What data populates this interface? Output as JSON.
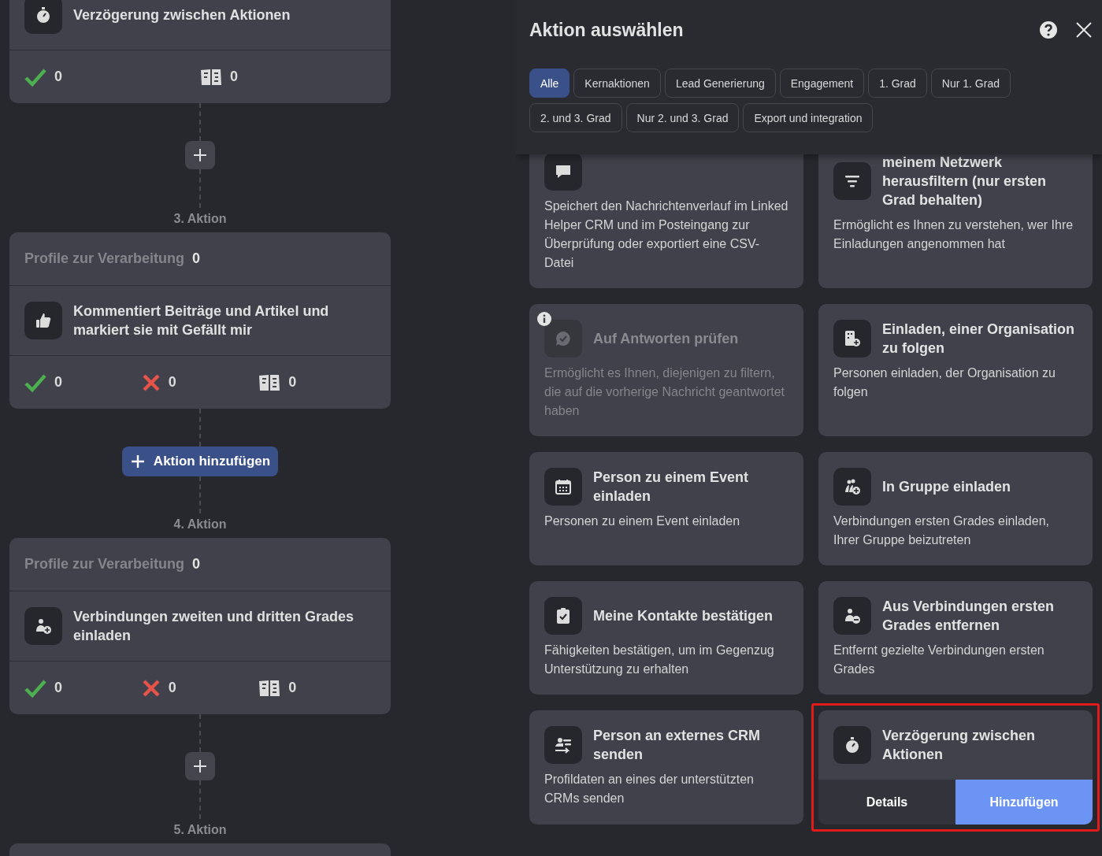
{
  "flow": [
    {
      "kind": "card",
      "action": {
        "kind": "delay",
        "title": "Verzögerung zwischen Aktionen"
      },
      "stats": [
        {
          "kind": "success",
          "value": "0"
        },
        {
          "kind": "skipped",
          "value": "0"
        }
      ]
    },
    {
      "kind": "connector",
      "button": {
        "kind": "plus"
      },
      "step": "3. Aktion"
    },
    {
      "kind": "card",
      "profiles": {
        "label": "Profile zur Verarbeitung",
        "value": "0"
      },
      "action": {
        "kind": "like",
        "title": "Kommentiert Beiträge und Artikel und markiert sie mit Gefällt mir"
      },
      "stats": [
        {
          "kind": "success",
          "value": "0"
        },
        {
          "kind": "failed",
          "value": "0"
        },
        {
          "kind": "skipped",
          "value": "0"
        }
      ]
    },
    {
      "kind": "connector",
      "button": {
        "kind": "labeled",
        "label": "Aktion hinzufügen"
      },
      "step": "4. Aktion"
    },
    {
      "kind": "card",
      "profiles": {
        "label": "Profile zur Verarbeitung",
        "value": "0"
      },
      "action": {
        "kind": "invite",
        "title": "Verbindungen zweiten und dritten Grades einladen"
      },
      "stats": [
        {
          "kind": "success",
          "value": "0"
        },
        {
          "kind": "failed",
          "value": "0"
        },
        {
          "kind": "skipped",
          "value": "0"
        }
      ]
    },
    {
      "kind": "connector",
      "button": {
        "kind": "plus"
      },
      "step": "5. Aktion"
    },
    {
      "kind": "card_stub"
    }
  ],
  "dialog": {
    "title": "Aktion auswählen",
    "filters": [
      {
        "label": "Alle",
        "selected": true
      },
      {
        "label": "Kernaktionen",
        "selected": false
      },
      {
        "label": "Lead Generierung",
        "selected": false
      },
      {
        "label": "Engagement",
        "selected": false
      },
      {
        "label": "1. Grad",
        "selected": false
      },
      {
        "label": "Nur 1. Grad",
        "selected": false
      },
      {
        "label": "2. und 3. Grad",
        "selected": false
      },
      {
        "label": "Nur 2. und 3. Grad",
        "selected": false
      },
      {
        "label": "Export und integration",
        "selected": false
      }
    ],
    "actions": [
      {
        "kind": "scrape",
        "description": "Speichert den Nachrichtenverlauf im Linked Helper CRM und im Posteingang zur Überprüfung oder exportiert eine CSV-Datei",
        "disabled": false,
        "highlighted": false
      },
      {
        "kind": "filter",
        "title": "meinem Netzwerk herausfiltern (nur ersten Grad behalten)",
        "description": "Ermöglicht es Ihnen zu verstehen, wer Ihre Einladungen angenommen hat",
        "disabled": false,
        "highlighted": false
      },
      {
        "kind": "replies",
        "title": "Auf Antworten prüfen",
        "description": "Ermöglicht es Ihnen, diejenigen zu filtern, die auf die vorherige Nachricht geantwortet haben",
        "disabled": true,
        "highlighted": false
      },
      {
        "kind": "organization",
        "title": "Einladen, einer Organisation zu folgen",
        "description": "Personen einladen, der Organisation zu folgen",
        "disabled": false,
        "highlighted": false
      },
      {
        "kind": "event",
        "title": "Person zu einem Event einladen",
        "description": "Personen zu einem Event einladen",
        "disabled": false,
        "highlighted": false
      },
      {
        "kind": "group",
        "title": "In Gruppe einladen",
        "description": "Verbindungen ersten Grades einladen, Ihrer Gruppe beizutreten",
        "disabled": false,
        "highlighted": false
      },
      {
        "kind": "endorse",
        "title": "Meine Kontakte bestätigen",
        "description": "Fähigkeiten bestätigen, um im Gegenzug Unterstützung zu erhalten",
        "disabled": false,
        "highlighted": false
      },
      {
        "kind": "remove",
        "title": "Aus Verbindungen ersten Grades entfernen",
        "description": "Entfernt gezielte Verbindungen ersten Grades",
        "disabled": false,
        "highlighted": false
      },
      {
        "kind": "crm",
        "title": "Person an externes CRM senden",
        "description": "Profildaten an eines der unterstützten CRMs senden",
        "disabled": false,
        "highlighted": false
      },
      {
        "kind": "delay",
        "title": "Verzögerung zwischen Aktionen",
        "disabled": false,
        "highlighted": true,
        "buttons": [
          {
            "label": "Details",
            "kind": "secondary"
          },
          {
            "label": "Hinzufügen",
            "kind": "primary"
          }
        ]
      }
    ]
  }
}
